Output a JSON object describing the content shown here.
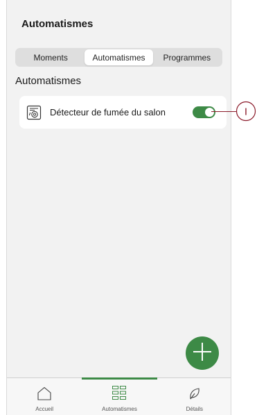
{
  "header": {
    "title": "Automatismes"
  },
  "segments": [
    {
      "label": "Moments",
      "active": false
    },
    {
      "label": "Automatismes",
      "active": true
    },
    {
      "label": "Programmes",
      "active": false
    }
  ],
  "section": {
    "title": "Automatismes"
  },
  "automation": {
    "label": "Détecteur de fumée du salon",
    "icon": "smoke-detector-icon",
    "enabled": true
  },
  "fab": {
    "icon": "plus-icon"
  },
  "tabs": [
    {
      "label": "Accueil",
      "icon": "home-icon",
      "active": false
    },
    {
      "label": "Automatismes",
      "icon": "grid-icon",
      "active": true
    },
    {
      "label": "Détails",
      "icon": "leaf-icon",
      "active": false
    }
  ],
  "callout": {
    "label": "I"
  },
  "colors": {
    "accent": "#3d8a46",
    "callout": "#8b1a2a"
  }
}
